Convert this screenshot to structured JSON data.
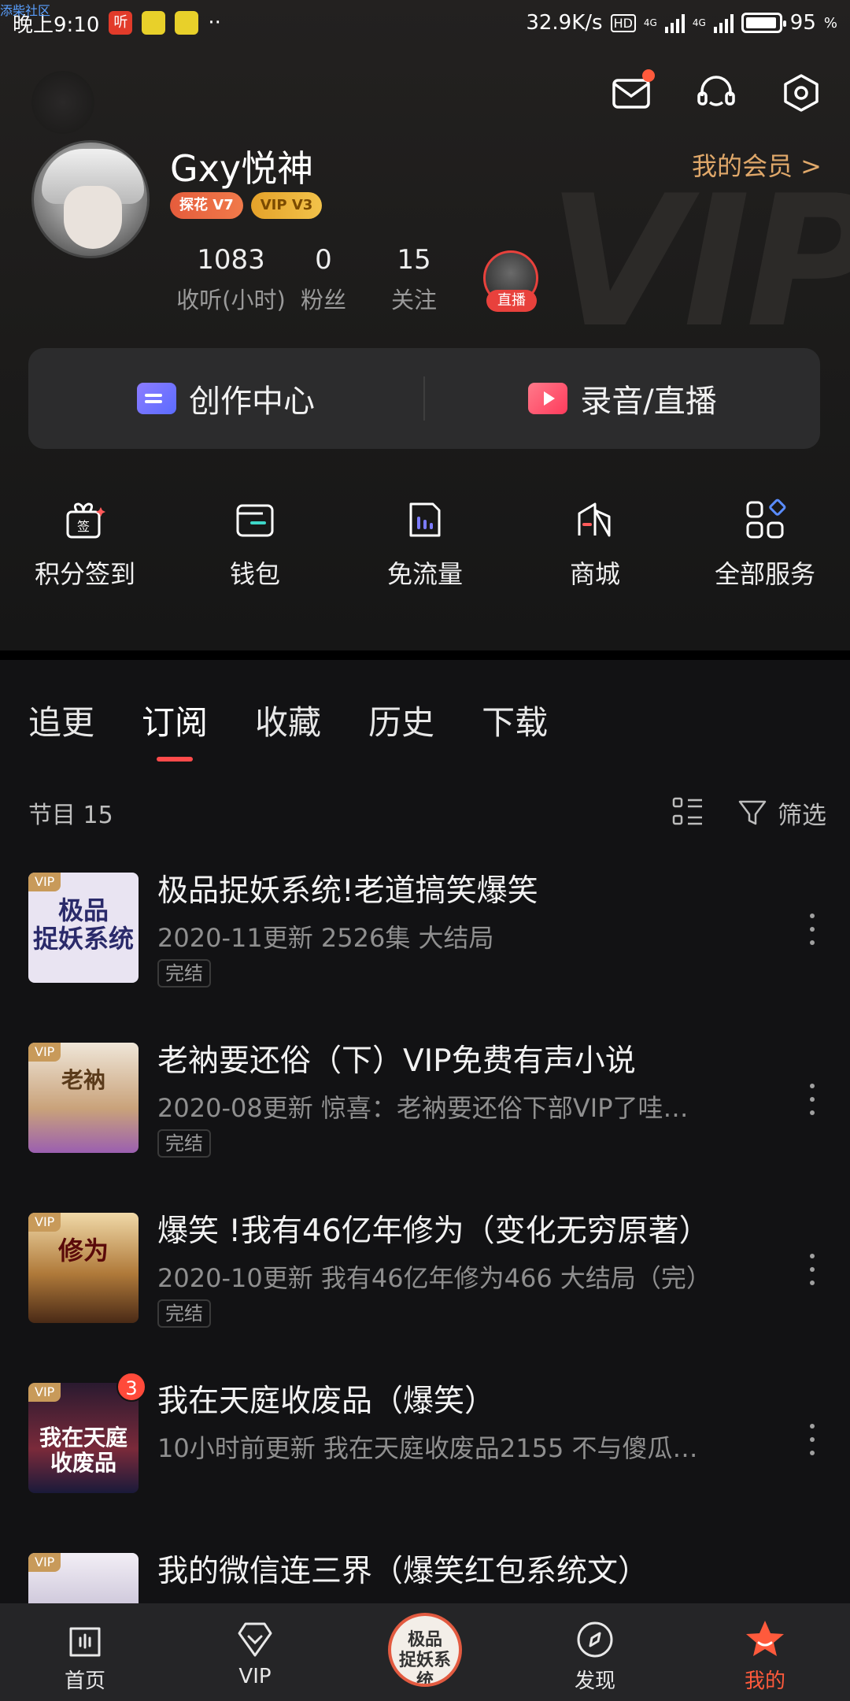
{
  "status_bar": {
    "corner_tag": "添柴社区",
    "time": "晚上9:10",
    "app_tag": "听",
    "more": "··",
    "speed": "32.9K/s",
    "hd": "HD",
    "net1": "4G",
    "net2": "4G",
    "battery": "95",
    "battery_unit": "%"
  },
  "profile": {
    "username": "Gxy悦神",
    "badge_tanhua": "探花 V7",
    "badge_vip": "VIP V3",
    "member_link": "我的会员 >",
    "stats": {
      "hours_value": "1083",
      "hours_label": "收听(小时)",
      "fans_value": "0",
      "fans_label": "粉丝",
      "follow_value": "15",
      "follow_label": "关注"
    },
    "live_tag": "直播"
  },
  "create": {
    "left_label": "创作中心",
    "right_label": "录音/直播"
  },
  "services": [
    {
      "label": "积分签到",
      "icon": "sign-in-gift-icon"
    },
    {
      "label": "钱包",
      "icon": "wallet-icon"
    },
    {
      "label": "免流量",
      "icon": "free-data-icon"
    },
    {
      "label": "商城",
      "icon": "mall-icon"
    },
    {
      "label": "全部服务",
      "icon": "all-services-icon"
    }
  ],
  "sign_char": "签",
  "background_text": "VIP",
  "tabs": [
    "追更",
    "订阅",
    "收藏",
    "历史",
    "下载"
  ],
  "active_tab": "订阅",
  "list": {
    "count_label": "节目 15",
    "filter_label": "筛选"
  },
  "items": [
    {
      "title": "极品捉妖系统!老道搞笑爆笑",
      "meta": "2020-11更新    2526集 大结局",
      "tag": "完结",
      "vip": "VIP",
      "cover_text": "极品\n捉妖系统",
      "cover_color": "#e9e4f2"
    },
    {
      "title": "老衲要还俗（下）VIP免费有声小说",
      "meta": "2020-08更新    惊喜：老衲要还俗下部VIP了哇…",
      "tag": "完结",
      "vip": "VIP",
      "cover_text": "老衲",
      "cover_color": "#d9c7a8"
    },
    {
      "title": "爆笑 !我有46亿年修为（变化无穷原著）",
      "meta": "2020-10更新    我有46亿年修为466 大结局（完）",
      "tag": "完结",
      "vip": "VIP",
      "cover_text": "修为",
      "cover_color": "#b07a3a"
    },
    {
      "title": "我在天庭收废品（爆笑）",
      "meta": "10小时前更新    我在天庭收废品2155 不与傻瓜…",
      "tag": "",
      "vip": "VIP",
      "badge": "3",
      "cover_text": "我在天庭\n收废品",
      "cover_color": "#5a2a3a"
    },
    {
      "title": "我的微信连三界（爆笑红包系统文）",
      "meta": "",
      "tag": "",
      "vip": "VIP",
      "cover_text": "",
      "cover_color": "#d8d0e0"
    }
  ],
  "bottom_nav": [
    {
      "label": "首页",
      "icon": "home-icon"
    },
    {
      "label": "VIP",
      "icon": "vip-diamond-icon"
    },
    {
      "label": "发现",
      "icon": "discover-icon"
    },
    {
      "label": "我的",
      "icon": "my-star-icon"
    }
  ],
  "player_text": "极品\n捉妖系统",
  "colors": {
    "accent": "#ff4b4b",
    "member_gold": "#e0a86a",
    "active_nav": "#ff5a3c"
  }
}
